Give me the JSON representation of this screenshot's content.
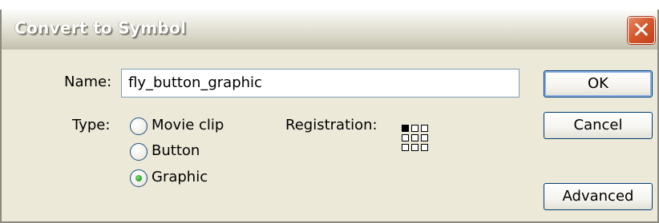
{
  "window": {
    "title": "Convert to Symbol",
    "close_glyph": "✕"
  },
  "form": {
    "name_label": "Name:",
    "name_value": "fly_button_graphic",
    "type_label": "Type:",
    "type_options": [
      {
        "label": "Movie clip",
        "selected": false
      },
      {
        "label": "Button",
        "selected": false
      },
      {
        "label": "Graphic",
        "selected": true
      }
    ],
    "registration_label": "Registration:",
    "registration_selected": "top-left"
  },
  "buttons": {
    "ok": "OK",
    "cancel": "Cancel",
    "advanced": "Advanced"
  },
  "colors": {
    "dialog_bg": "#ece9d8",
    "close_button": "#d65a2e",
    "radio_dot": "#2ea62a"
  }
}
